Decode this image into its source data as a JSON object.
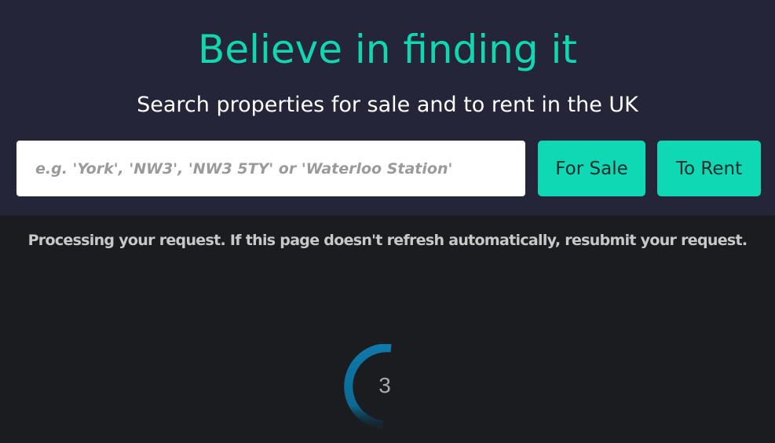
{
  "hero": {
    "title": "Believe in finding it",
    "subtitle": "Search properties for sale and to rent in the UK"
  },
  "search": {
    "placeholder": "e.g. 'York', 'NW3', 'NW3 5TY' or 'Waterloo Station'",
    "value": ""
  },
  "buttons": {
    "for_sale": "For Sale",
    "to_rent": "To Rent"
  },
  "status": {
    "message": "Processing your request. If this page doesn't refresh automatically, resubmit your request."
  },
  "countdown": {
    "value": "3"
  },
  "colors": {
    "hero_background": "#25253a",
    "page_background": "#1b1c1f",
    "accent": "#0fd9b4",
    "spinner": "#0f78a8"
  }
}
